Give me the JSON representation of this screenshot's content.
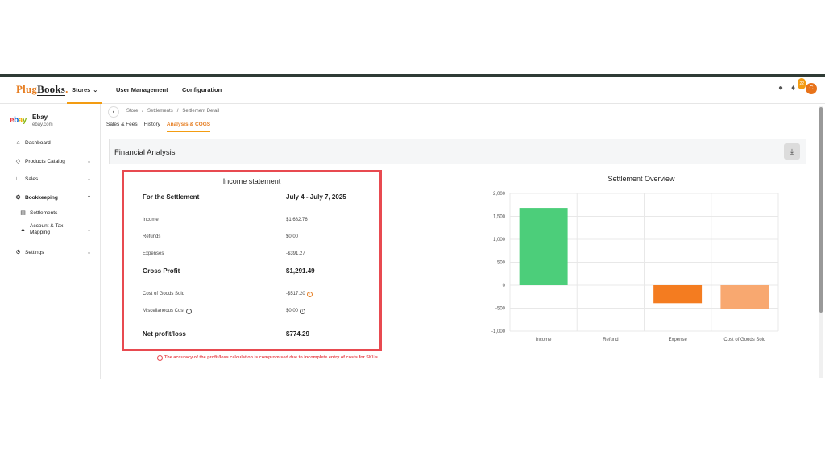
{
  "app": {
    "logo": {
      "part1": "Plug",
      "part2": "Books"
    }
  },
  "topnav": {
    "items": [
      {
        "label": "Stores",
        "chevron": "v"
      },
      {
        "label": "User Management"
      },
      {
        "label": "Configuration"
      }
    ],
    "notification_count": "22",
    "avatar_initial": "C",
    "icons": [
      "lightbulb-icon",
      "bell-icon"
    ]
  },
  "sidebar": {
    "store": {
      "name": "Ebay",
      "domain": "ebay.com"
    },
    "items": [
      {
        "label": "Dashboard",
        "icon": "home-icon"
      },
      {
        "label": "Products Catalog",
        "icon": "tag-icon"
      },
      {
        "label": "Sales",
        "icon": "chart-line-icon"
      },
      {
        "label": "Bookkeeping",
        "icon": "gear-icon"
      },
      {
        "label": "Settlements",
        "icon": "document-icon"
      },
      {
        "label": "Account & Tax Mapping",
        "icon": "sitemap-icon"
      },
      {
        "label": "Settings",
        "icon": "gear-icon"
      }
    ]
  },
  "breadcrumb": [
    "Store",
    "Settlements",
    "Settlement Detail"
  ],
  "tabs": [
    {
      "label": "Sales & Fees"
    },
    {
      "label": "History"
    },
    {
      "label": "Analysis & COGS",
      "active": true
    }
  ],
  "financial_analysis": {
    "title": "Financial Analysis"
  },
  "income_statement": {
    "title": "Income statement",
    "period_label": "For the Settlement",
    "period_value": "July 4 - July 7, 2025",
    "income_label": "Income",
    "income_value": "$1,682.76",
    "refunds_label": "Refunds",
    "refunds_value": "$0.00",
    "expenses_label": "Expenses",
    "expenses_value": "-$391.27",
    "gross_profit_label": "Gross Profit",
    "gross_profit_value": "$1,291.49",
    "cogs_label": "Cost of Goods Sold",
    "cogs_value": "-$517.20",
    "misc_label": "Miscellaneous Cost",
    "misc_value": "$0.00",
    "net_label": "Net profit/loss",
    "net_value": "$774.29"
  },
  "warning": "The accuracy of the profit/loss calculation is compromised due to incomplete entry of costs for SKUs.",
  "chart_data": {
    "type": "bar",
    "title": "Settlement Overview",
    "categories": [
      "Income",
      "Refund",
      "Expense",
      "Cost of Goods Sold"
    ],
    "values": [
      1682.76,
      0,
      -391.27,
      -517.2
    ],
    "colors": [
      "#4cce7a",
      "#4cce7a",
      "#f47c20",
      "#f8a870"
    ],
    "ylim": [
      -1000,
      2000
    ],
    "yticks": [
      2000,
      1500,
      1000,
      500,
      0,
      -500,
      -1000
    ],
    "ytick_labels": [
      "2,000",
      "1,500",
      "1,000",
      "500",
      "0",
      "-500",
      "-1,000"
    ],
    "grid": true
  }
}
